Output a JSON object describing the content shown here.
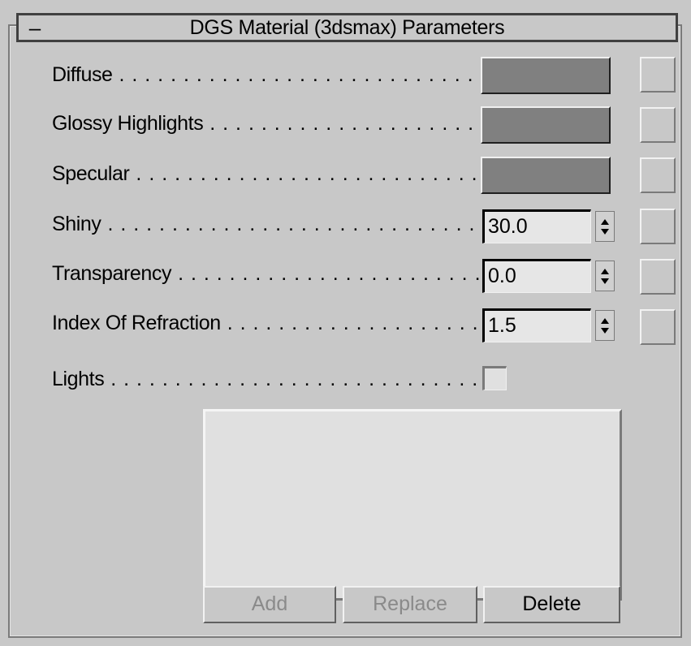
{
  "header": {
    "collapse_symbol": "–",
    "title": "DGS Material (3dsmax) Parameters"
  },
  "params": {
    "diffuse_label": "Diffuse",
    "glossy_label": "Glossy Highlights",
    "specular_label": "Specular",
    "shiny_label": "Shiny",
    "shiny_value": "30.0",
    "transparency_label": "Transparency",
    "transparency_value": "0.0",
    "ior_label": "Index Of Refraction",
    "ior_value": "1.5",
    "lights_label": "Lights"
  },
  "colors": {
    "diffuse": "#808080",
    "glossy": "#808080",
    "specular": "#808080"
  },
  "buttons": {
    "add": "Add",
    "replace": "Replace",
    "delete": "Delete"
  }
}
